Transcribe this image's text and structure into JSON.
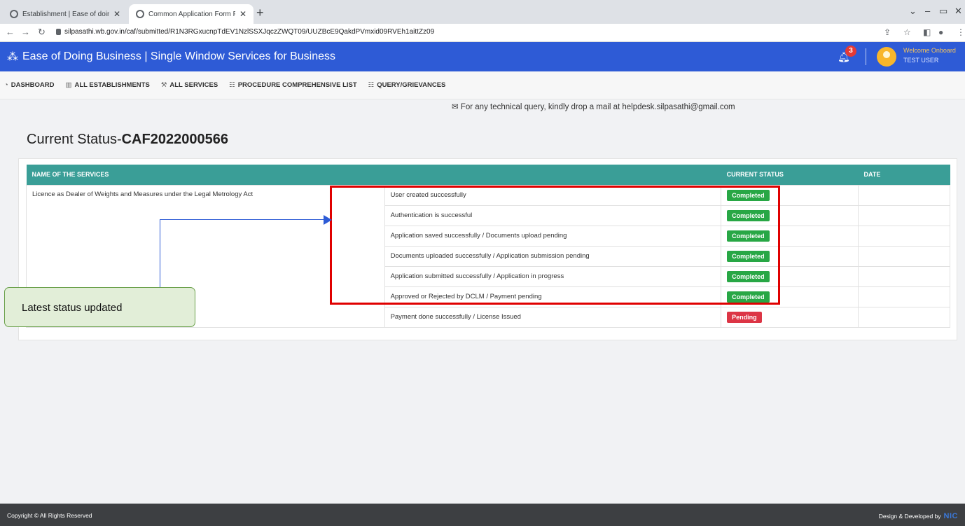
{
  "browser": {
    "tabs": [
      {
        "title": "Establishment | Ease of doing bu",
        "active": false
      },
      {
        "title": "Common Application Form Previ",
        "active": true
      }
    ],
    "new_tab": "+",
    "url": "silpasathi.wb.gov.in/caf/submitted/R1N3RGxucnpTdEV1NzlSSXJqczZWQT09/UUZBcE9QakdPVmxid09RVEh1aittZz09"
  },
  "header": {
    "title": "Ease of Doing Business | Single Window Services for Business",
    "notification_count": "3",
    "welcome": "Welcome Onboard",
    "user": "TEST USER",
    "accent": "#2e5bd6"
  },
  "menu": [
    {
      "label": "DASHBOARD",
      "icon": "dashboard-icon"
    },
    {
      "label": "ALL ESTABLISHMENTS",
      "icon": "building-icon"
    },
    {
      "label": "ALL SERVICES",
      "icon": "wrench-icon"
    },
    {
      "label": "PROCEDURE COMPREHENSIVE LIST",
      "icon": "list-icon"
    },
    {
      "label": "QUERY/GRIEVANCES",
      "icon": "list-icon"
    }
  ],
  "helpline": "For any technical query, kindly drop a mail at helpdesk.silpasathi@gmail.com",
  "page": {
    "title_prefix": "Current Status-",
    "caf_id": "CAF2022000566"
  },
  "table": {
    "headers": [
      "NAME OF THE SERVICES",
      "",
      "CURRENT STATUS",
      "DATE"
    ],
    "service_name": "Licence as Dealer of Weights and Measures under the Legal Metrology Act",
    "rows": [
      {
        "step": "User created successfully",
        "status": "Completed",
        "date": ""
      },
      {
        "step": "Authentication is successful",
        "status": "Completed",
        "date": ""
      },
      {
        "step": "Application saved successfully / Documents upload pending",
        "status": "Completed",
        "date": ""
      },
      {
        "step": "Documents uploaded successfully / Application submission pending",
        "status": "Completed",
        "date": ""
      },
      {
        "step": "Application submitted successfully / Application in progress",
        "status": "Completed",
        "date": ""
      },
      {
        "step": "Approved or Rejected by DCLM / Payment pending",
        "status": "Completed",
        "date": ""
      },
      {
        "step": "Payment done successfully / License Issued",
        "status": "Pending",
        "date": ""
      }
    ],
    "status_colors": {
      "Completed": "#28a745",
      "Pending": "#dc3545"
    },
    "header_color": "#3a9e97"
  },
  "annotation": {
    "callout_text": "Latest status updated",
    "highlight_color": "#e00000"
  },
  "footer": {
    "copyright": "Copyright © All Rights Reserved",
    "credit": "Design & Developed by",
    "credit_logo": "NIC"
  }
}
